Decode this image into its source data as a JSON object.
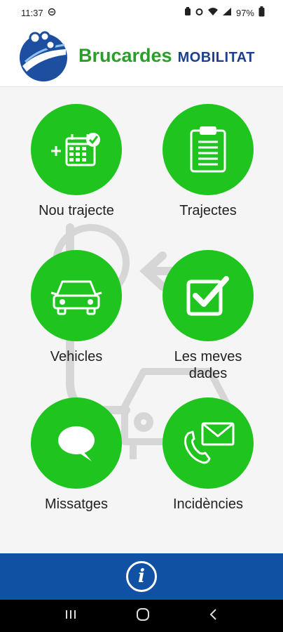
{
  "status": {
    "time": "11:37",
    "battery": "97%"
  },
  "header": {
    "brand": "Brucardes",
    "subtitle": "MOBILITAT",
    "logo_icon": "brucardes-logo"
  },
  "tiles": [
    {
      "label": "Nou trajecte",
      "icon": "calendar-add-icon"
    },
    {
      "label": "Trajectes",
      "icon": "clipboard-icon"
    },
    {
      "label": "Vehicles",
      "icon": "car-icon"
    },
    {
      "label": "Les meves dades",
      "icon": "checkbox-icon"
    },
    {
      "label": "Missatges",
      "icon": "chat-bubble-icon"
    },
    {
      "label": "Incidències",
      "icon": "phone-mail-icon"
    }
  ],
  "footer": {
    "info_icon": "info-icon"
  },
  "colors": {
    "green": "#1fc41f",
    "blue": "#1151a3",
    "brand_green": "#2a9d2a",
    "brand_blue": "#1c3f8f"
  }
}
